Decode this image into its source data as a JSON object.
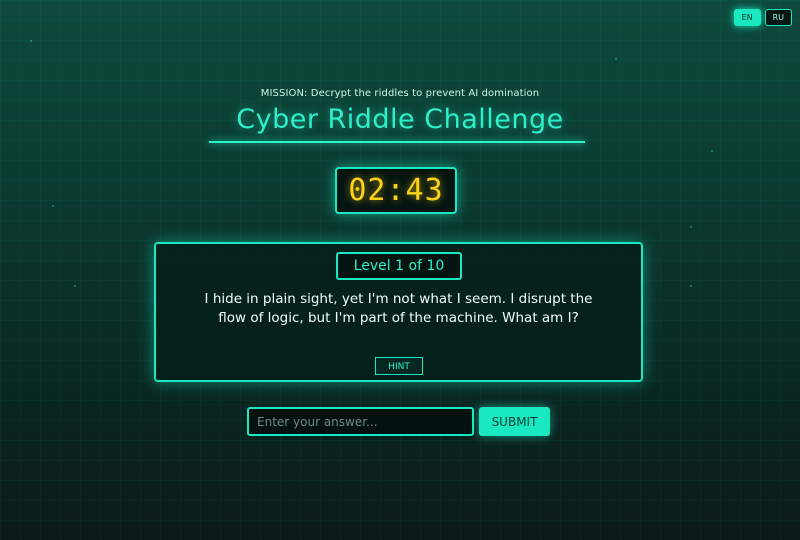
{
  "language": {
    "options": [
      {
        "label": "EN",
        "selected": true
      },
      {
        "label": "RU",
        "selected": false
      }
    ]
  },
  "header": {
    "mission": "MISSION: Decrypt the riddles to prevent AI domination",
    "title": "Cyber Riddle Challenge"
  },
  "timer": {
    "display": "02:43"
  },
  "riddle": {
    "level": "Level 1 of 10",
    "text": "I hide in plain sight, yet I'm not what I seem. I disrupt the flow of logic, but I'm part of the machine. What am I?",
    "hint_label": "HINT"
  },
  "answer": {
    "placeholder": "Enter your answer...",
    "value": "",
    "submit_label": "SUBMIT"
  },
  "colors": {
    "accent": "#19e8c0",
    "timer": "#ffd21a",
    "background_top": "#0d4a3d",
    "background_bottom": "#0b1a18"
  }
}
